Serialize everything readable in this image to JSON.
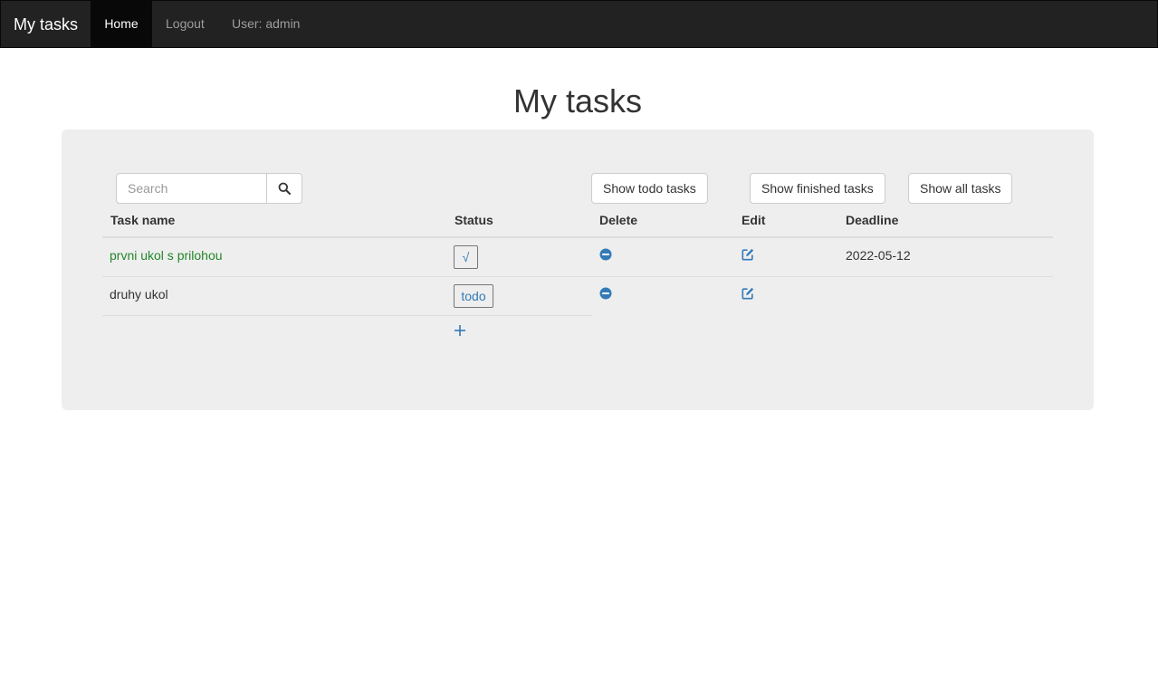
{
  "navbar": {
    "brand": "My tasks",
    "home": "Home",
    "logout": "Logout",
    "user": "User: admin"
  },
  "page": {
    "title": "My tasks"
  },
  "toolbar": {
    "search_placeholder": "Search",
    "search_value": "",
    "show_todo": "Show todo tasks",
    "show_finished": "Show finished tasks",
    "show_all": "Show all tasks"
  },
  "table": {
    "headers": {
      "task_name": "Task name",
      "status": "Status",
      "delete": "Delete",
      "edit": "Edit",
      "deadline": "Deadline"
    },
    "rows": [
      {
        "name": "prvni ukol s prilohou",
        "status": "√",
        "deadline": "2022-05-12"
      },
      {
        "name": "druhy ukol",
        "status": "todo",
        "deadline": ""
      }
    ]
  },
  "colors": {
    "navbar_bg": "#222222",
    "panel_bg": "#eeeeee",
    "accent": "#337ab7",
    "done_task": "#22862a"
  },
  "icons": {
    "search": "search-icon",
    "delete": "minus-circle-icon",
    "edit": "edit-icon",
    "add": "plus-icon"
  }
}
